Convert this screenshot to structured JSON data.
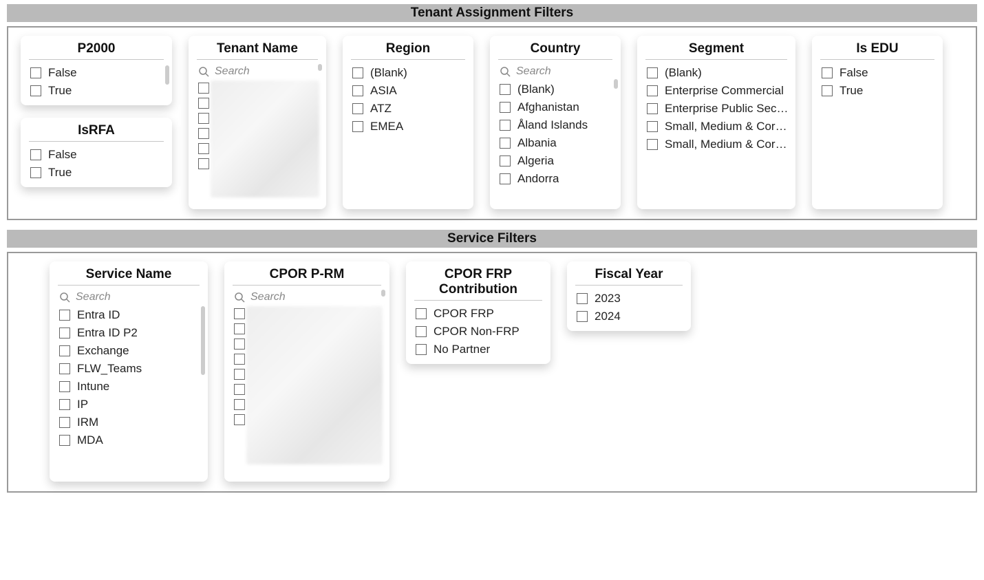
{
  "sections": {
    "tenant": {
      "title": "Tenant Assignment Filters"
    },
    "service": {
      "title": "Service Filters"
    }
  },
  "search_placeholder": "Search",
  "slicers": {
    "p2000": {
      "title": "P2000",
      "items": [
        "False",
        "True"
      ]
    },
    "isrfa": {
      "title": "IsRFA",
      "items": [
        "False",
        "True"
      ]
    },
    "tenant_name": {
      "title": "Tenant Name"
    },
    "region": {
      "title": "Region",
      "items": [
        "(Blank)",
        "ASIA",
        "ATZ",
        "EMEA"
      ]
    },
    "country": {
      "title": "Country",
      "items": [
        "(Blank)",
        "Afghanistan",
        "Åland Islands",
        "Albania",
        "Algeria",
        "Andorra"
      ]
    },
    "segment": {
      "title": "Segment",
      "items": [
        "(Blank)",
        "Enterprise Commercial",
        "Enterprise Public Sector",
        "Small, Medium & Corp...",
        "Small, Medium & Corp..."
      ]
    },
    "is_edu": {
      "title": "Is EDU",
      "items": [
        "False",
        "True"
      ]
    },
    "service_name": {
      "title": "Service Name",
      "items": [
        "Entra ID",
        "Entra ID P2",
        "Exchange",
        "FLW_Teams",
        "Intune",
        "IP",
        "IRM",
        "MDA"
      ]
    },
    "cpor_prm": {
      "title": "CPOR P-RM"
    },
    "cpor_frp": {
      "title": "CPOR FRP Contribution",
      "items": [
        "CPOR FRP",
        "CPOR Non-FRP",
        "No Partner"
      ]
    },
    "fiscal_year": {
      "title": "Fiscal Year",
      "items": [
        "2023",
        "2024"
      ]
    }
  }
}
